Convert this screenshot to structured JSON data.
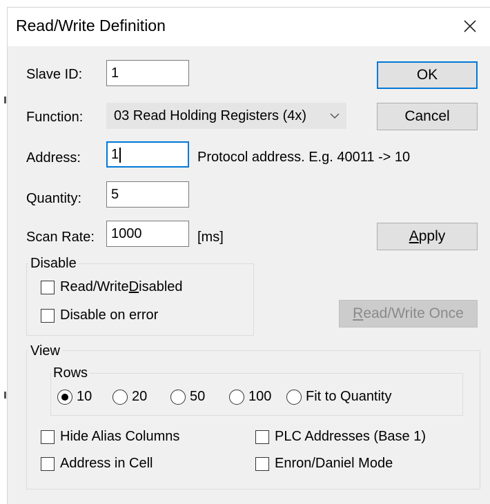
{
  "window": {
    "title": "Read/Write Definition"
  },
  "fields": {
    "slave_id_label": "Slave ID:",
    "slave_id_value": "1",
    "function_label": "Function:",
    "function_value": "03 Read Holding Registers (4x)",
    "address_label": "Address:",
    "address_value": "1",
    "address_hint": "Protocol address. E.g. 40011 -> 10",
    "quantity_label": "Quantity:",
    "quantity_value": "5",
    "scan_rate_label": "Scan Rate:",
    "scan_rate_value": "1000",
    "scan_rate_unit": "[ms]"
  },
  "buttons": {
    "ok": "OK",
    "cancel": "Cancel",
    "apply_prefix": "",
    "apply_mnemonic": "A",
    "apply_rest": "pply",
    "rw_once_mnemonic": "R",
    "rw_once_rest": "ead/Write Once"
  },
  "disable_group": {
    "title": "Disable",
    "rw_disabled_prefix": "Read/Write ",
    "rw_disabled_mnemonic": "D",
    "rw_disabled_rest": "isabled",
    "rw_disabled_checked": false,
    "disable_on_error": "Disable on error",
    "disable_on_error_checked": false
  },
  "view_group": {
    "title": "View",
    "rows_title": "Rows",
    "rows_options": [
      "10",
      "20",
      "50",
      "100",
      "Fit to Quantity"
    ],
    "rows_selected": "10",
    "hide_alias_columns": "Hide Alias Columns",
    "plc_addresses": "PLC Addresses (Base 1)",
    "address_in_cell": "Address in Cell",
    "enron_daniel_mode": "Enron/Daniel Mode"
  },
  "icons": {
    "close": "close-icon",
    "dropdown": "chevron-down-icon"
  },
  "colors": {
    "focus_accent": "#0078d7",
    "dialog_bg": "#f0f0f0"
  }
}
